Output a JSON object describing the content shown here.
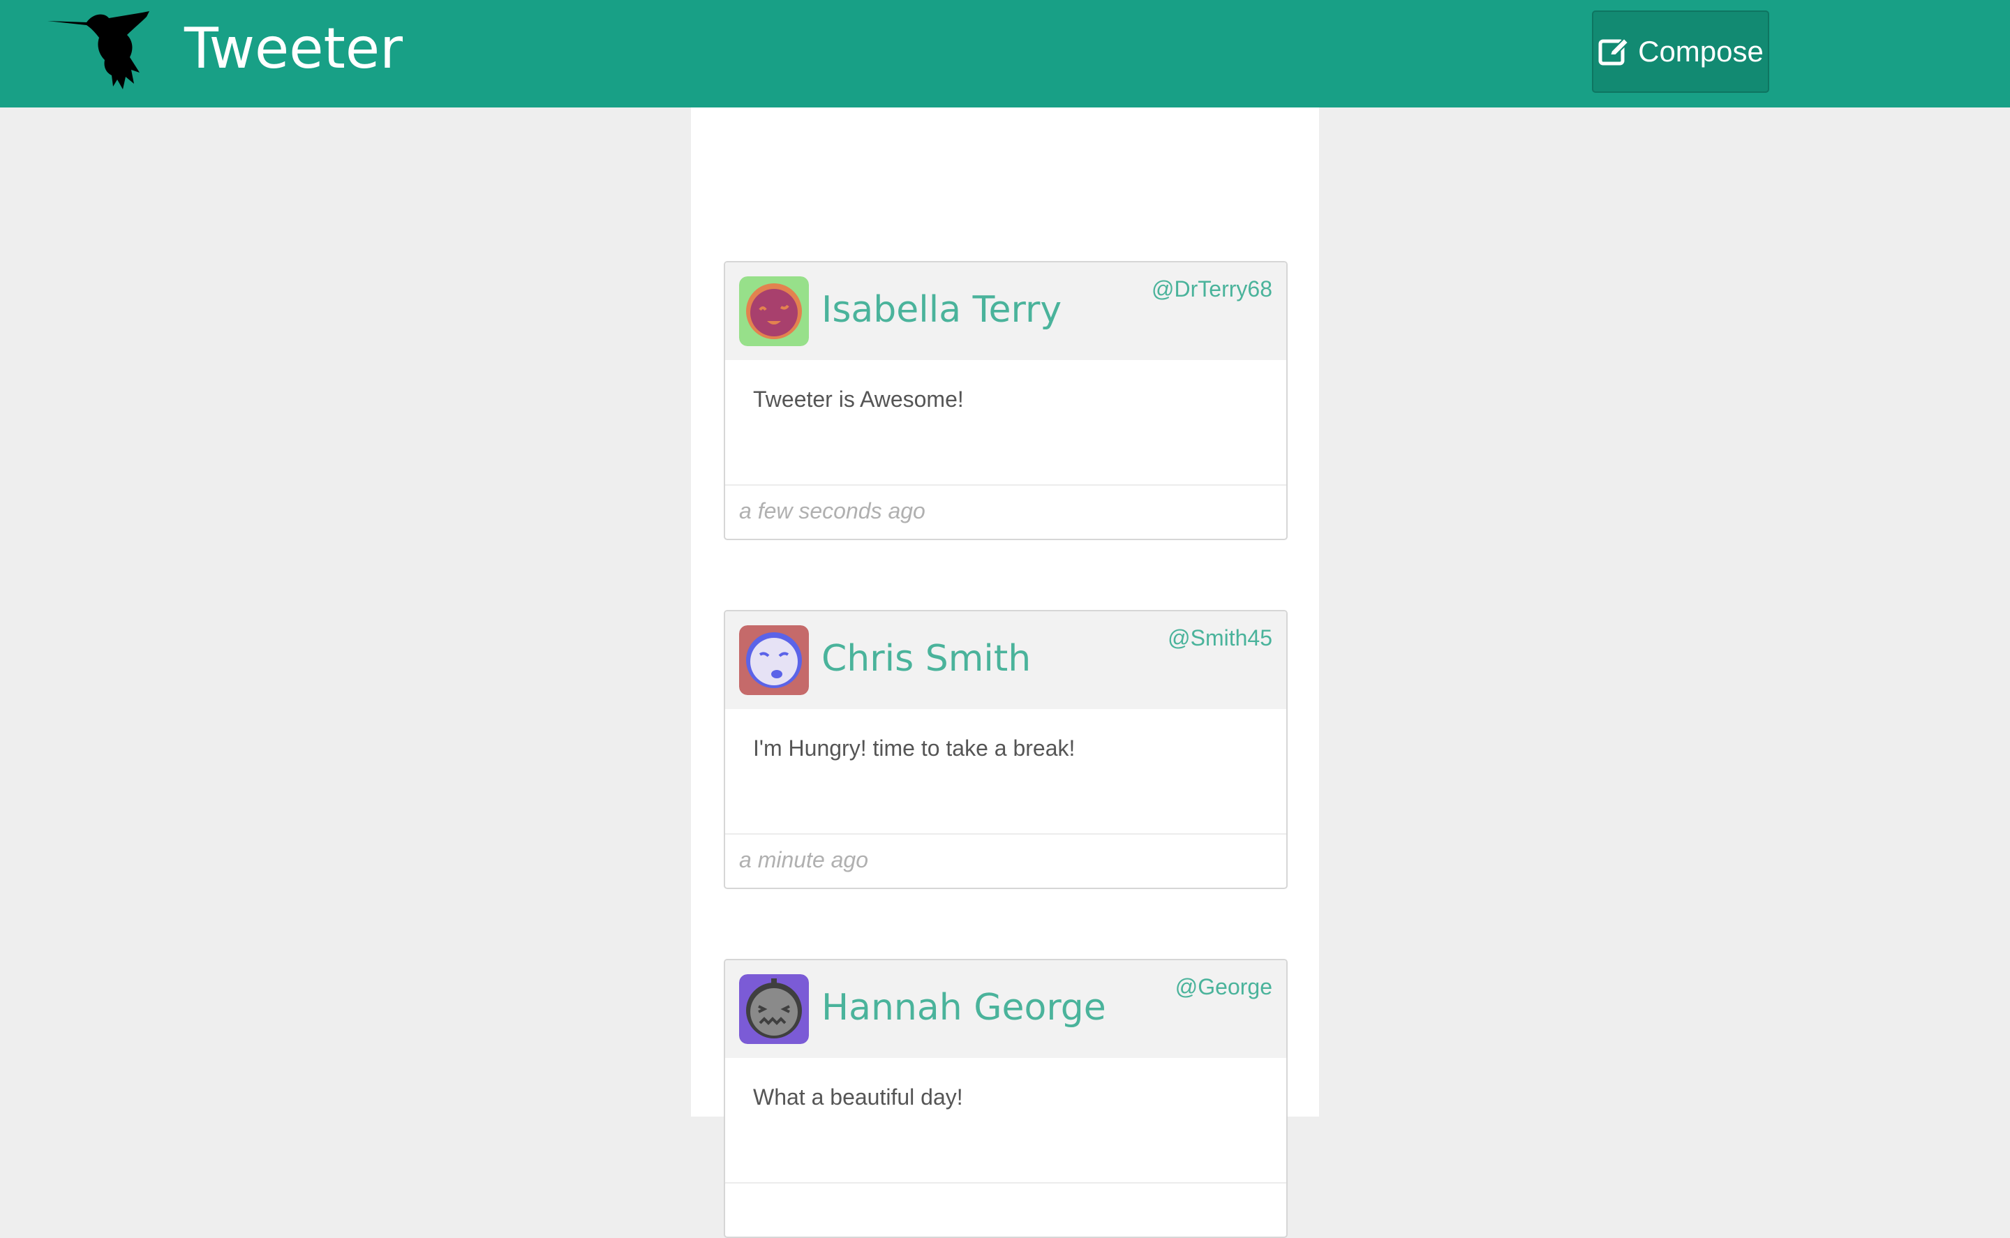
{
  "header": {
    "brand": "Tweeter",
    "compose_label": "Compose",
    "accent_color": "#18a086"
  },
  "tweets": [
    {
      "name": "Isabella Terry",
      "handle": "@DrTerry68",
      "text": "Tweeter is Awesome!",
      "time": "a few seconds ago",
      "avatar_icon": "smiling-face-avatar",
      "avatar_bg": "#97e08a"
    },
    {
      "name": "Chris Smith",
      "handle": "@Smith45",
      "text": "I'm Hungry! time to take a break!",
      "time": "a minute ago",
      "avatar_icon": "sleepy-face-avatar",
      "avatar_bg": "#c56a6a"
    },
    {
      "name": "Hannah George",
      "handle": "@George",
      "text": "What a beautiful day!",
      "time": "",
      "avatar_icon": "grimacing-face-avatar",
      "avatar_bg": "#7b5bd6"
    }
  ]
}
